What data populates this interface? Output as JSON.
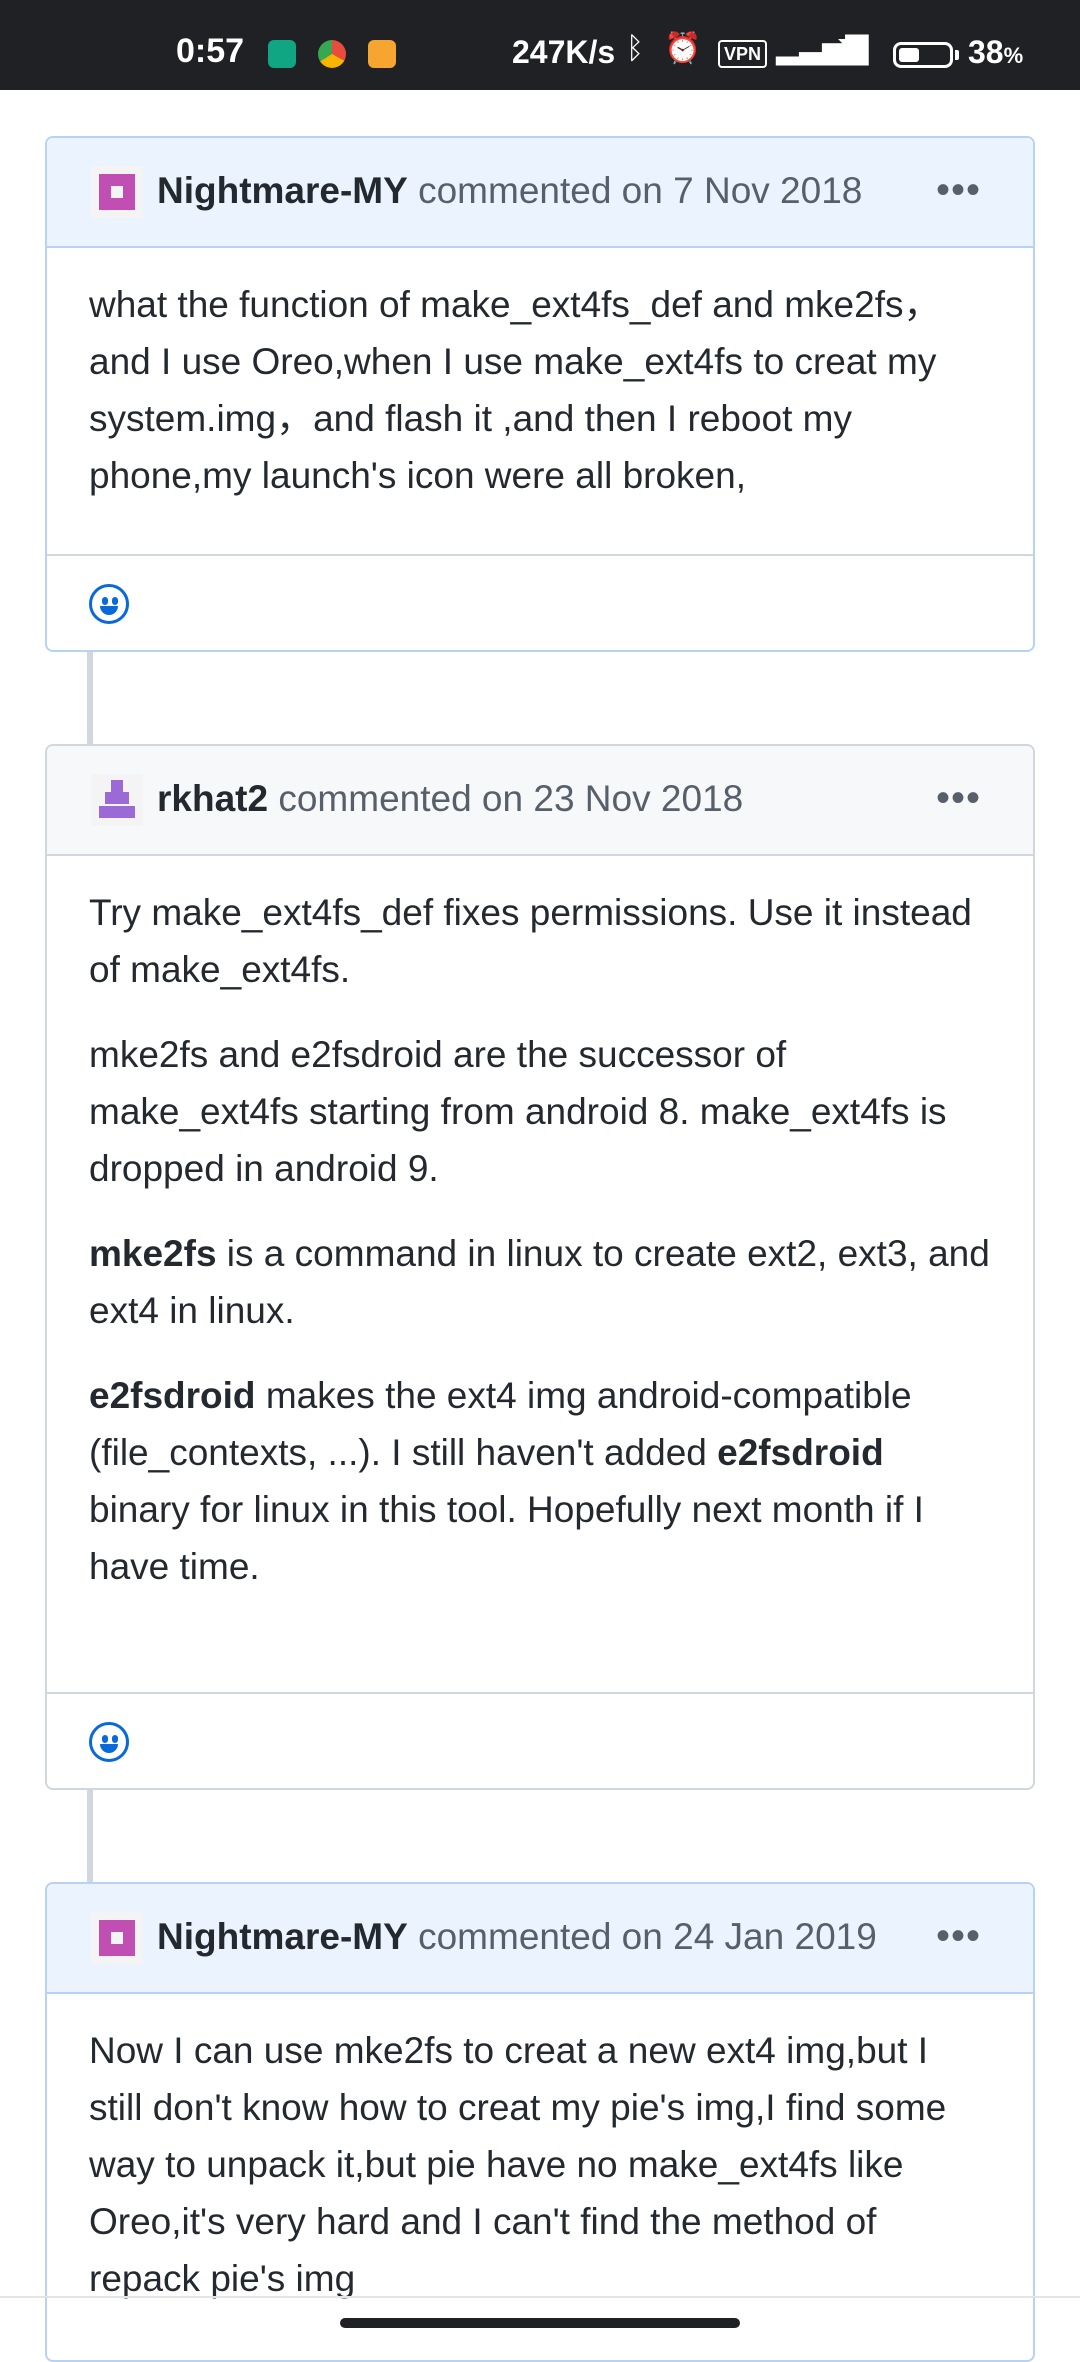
{
  "status_bar": {
    "time": "0:57",
    "network_speed": "247K/s",
    "vpn_label": "VPN",
    "battery_percent": "38",
    "battery_unit": "%",
    "icons": [
      "shield-icon",
      "browser-icon",
      "note-app-icon",
      "bluetooth-icon",
      "alarm-icon",
      "vpn-icon",
      "signal-icon",
      "wifi-icon",
      "battery-icon"
    ]
  },
  "comments": [
    {
      "author": "Nightmare-MY",
      "meta": "commented on 7 Nov 2018",
      "is_author_highlight": true,
      "paragraphs": [
        "what the function of make_ext4fs_def and mke2fs，and I use Oreo,when I use make_ext4fs to creat my system.img，and flash it ,and then I reboot my phone,my launch's icon were all broken,"
      ]
    },
    {
      "author": "rkhat2",
      "meta": "commented on 23 Nov 2018",
      "is_author_highlight": false,
      "p1": "Try make_ext4fs_def fixes permissions. Use it instead of make_ext4fs.",
      "p2": "mke2fs and e2fsdroid are the successor of make_ext4fs starting from android 8. make_ext4fs is dropped in android 9.",
      "p3_bold": "mke2fs",
      "p3_rest": " is a command in linux to create ext2, ext3, and ext4 in linux.",
      "p4_bold1": "e2fsdroid",
      "p4_mid": " makes the ext4 img android-compatible (file_contexts, ...). I still haven't added ",
      "p4_bold2": "e2fsdroid",
      "p4_end": " binary for linux in this tool. Hopefully next month if I have time."
    },
    {
      "author": "Nightmare-MY",
      "meta": "commented on 24 Jan 2019",
      "is_author_highlight": true,
      "paragraphs": [
        "Now I can use mke2fs to creat a new ext4 img,but I still don't know how to creat my pie's img,I find some way to unpack it,but pie have no make_ext4fs like Oreo,it's very hard and I can't find the method of repack pie's img"
      ]
    }
  ],
  "more_glyph": "•••",
  "colors": {
    "link_blue": "#0969da",
    "author_header_bg": "#ebf3ff",
    "header_bg": "#f6f8fa",
    "border": "#d0d7de"
  }
}
